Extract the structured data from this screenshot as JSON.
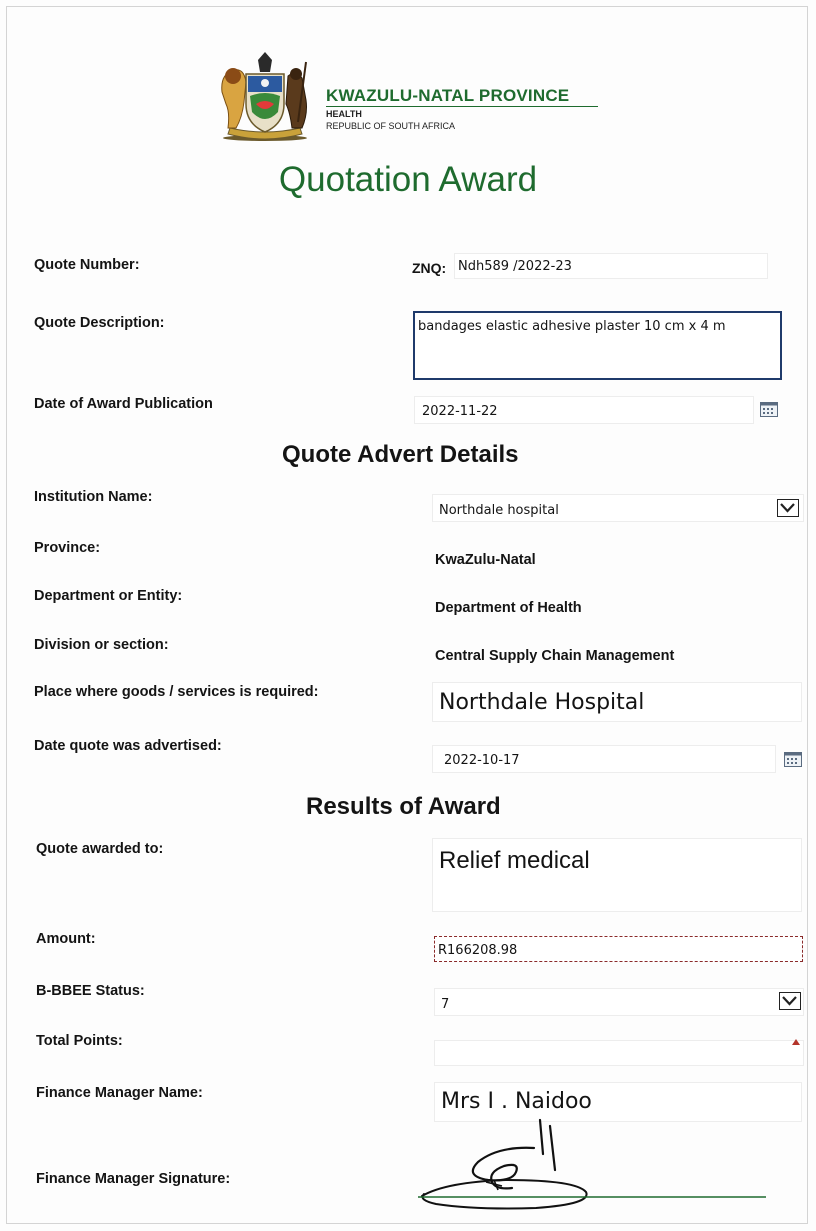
{
  "header": {
    "province_title": "KWAZULU-NATAL PROVINCE",
    "department": "HEALTH",
    "country": "REPUBLIC OF SOUTH AFRICA",
    "form_title": "Quotation Award",
    "brand_color": "#1e6b2e"
  },
  "quote": {
    "number_label": "Quote Number:",
    "number_prefix": "ZNQ:",
    "number_value": "Ndh589 /2022-23",
    "description_label": "Quote Description:",
    "description_value": "bandages  elastic adhesive plaster 10 cm  x 4 m",
    "award_date_label": "Date of Award Publication",
    "award_date_value": "2022-11-22"
  },
  "advert": {
    "heading": "Quote Advert Details",
    "institution_label": "Institution Name:",
    "institution_value": "Northdale hospital",
    "province_label": "Province:",
    "province_value": "KwaZulu-Natal",
    "department_label": "Department or Entity:",
    "department_value": "Department of Health",
    "division_label": "Division or section:",
    "division_value": "Central Supply Chain Management",
    "place_label": "Place where goods /  services is required:",
    "place_value": "Northdale Hospital",
    "advertised_label": "Date quote was advertised:",
    "advertised_value": "2022-10-17"
  },
  "results": {
    "heading": "Results of Award",
    "awarded_label": "Quote awarded to:",
    "awarded_value": "Relief medical",
    "amount_label": "Amount:",
    "amount_value": "R166208.98",
    "bbbee_label": "B-BBEE Status:",
    "bbbee_value": "7",
    "points_label": "Total Points:",
    "points_value": "",
    "manager_label": "Finance Manager Name:",
    "manager_value": "Mrs I . Naidoo",
    "signature_label": "Finance Manager Signature:"
  },
  "icons": {
    "calendar": "calendar-icon",
    "dropdown": "chevron-down-icon",
    "crest": "coat-of-arms-icon"
  }
}
